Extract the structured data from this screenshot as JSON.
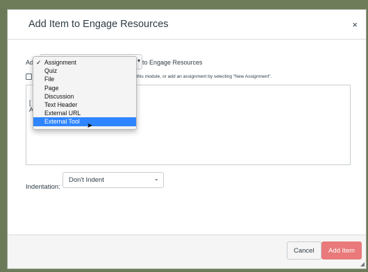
{
  "modal": {
    "title": "Add Item to Engage Resources",
    "close_label": "×"
  },
  "add_row": {
    "prefix": "Ad",
    "suffix": "to Engage Resources"
  },
  "hint": {
    "text": "with this module, or add an assignment by selecting \"New Assignment\"."
  },
  "listbox": {
    "fragment1": "[",
    "fragment2": "A"
  },
  "dropdown": {
    "selected_check": "✓",
    "options": [
      "Assignment",
      "Quiz",
      "File",
      "Page",
      "Discussion",
      "Text Header",
      "External URL",
      "External Tool"
    ],
    "selected_index": 0,
    "highlighted_index": 7
  },
  "indentation": {
    "label": "Indentation:",
    "value": "Don't Indent"
  },
  "footer": {
    "cancel_label": "Cancel",
    "add_label": "Add Item"
  },
  "colors": {
    "accent": "#2f85ff",
    "add_button": "#e9797a"
  }
}
